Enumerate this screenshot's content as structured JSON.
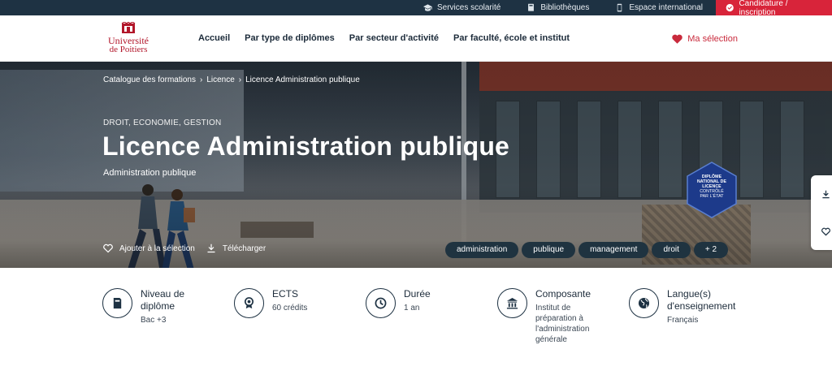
{
  "topbar": {
    "links": [
      {
        "label": "Services scolarité",
        "icon": "graduation-cap-icon"
      },
      {
        "label": "Bibliothèques",
        "icon": "book-icon"
      },
      {
        "label": "Espace international",
        "icon": "phone-icon"
      }
    ],
    "cta": {
      "label": "Candidature / inscription",
      "icon": "check-circle-icon"
    }
  },
  "logo": {
    "line1": "Université",
    "line2": "de Poitiers",
    "small": "de"
  },
  "nav": {
    "items": [
      "Accueil",
      "Par type de diplômes",
      "Par secteur d'activité",
      "Par faculté, école et institut"
    ],
    "my_selection": "Ma sélection"
  },
  "hero": {
    "breadcrumb": [
      "Catalogue des formations",
      "Licence",
      "Licence Administration publique"
    ],
    "kicker": "DROIT, ECONOMIE, GESTION",
    "title": "Licence Administration publique",
    "subtitle": "Administration publique",
    "badge": {
      "l1": "DIPLÔME",
      "l2": "NATIONAL DE",
      "l3": "LICENCE",
      "l4": "CONTRÔLÉ",
      "l5": "PAR L'ÉTAT"
    },
    "actions": {
      "add": "Ajouter à la sélection",
      "download": "Télécharger"
    },
    "tags": [
      "administration",
      "publique",
      "management",
      "droit",
      "+ 2"
    ]
  },
  "info": [
    {
      "label": "Niveau de diplôme",
      "value": "Bac +3",
      "icon": "diploma-icon"
    },
    {
      "label": "ECTS",
      "value": "60 crédits",
      "icon": "medal-icon"
    },
    {
      "label": "Durée",
      "value": "1 an",
      "icon": "clock-icon"
    },
    {
      "label": "Composante",
      "value": "Institut de préparation à l'administration générale",
      "icon": "institution-icon"
    },
    {
      "label": "Langue(s) d'enseignement",
      "value": "Français",
      "icon": "globe-icon"
    }
  ],
  "colors": {
    "navy": "#1e3243",
    "red": "#d8243a",
    "badge": "#1d3a8a"
  }
}
